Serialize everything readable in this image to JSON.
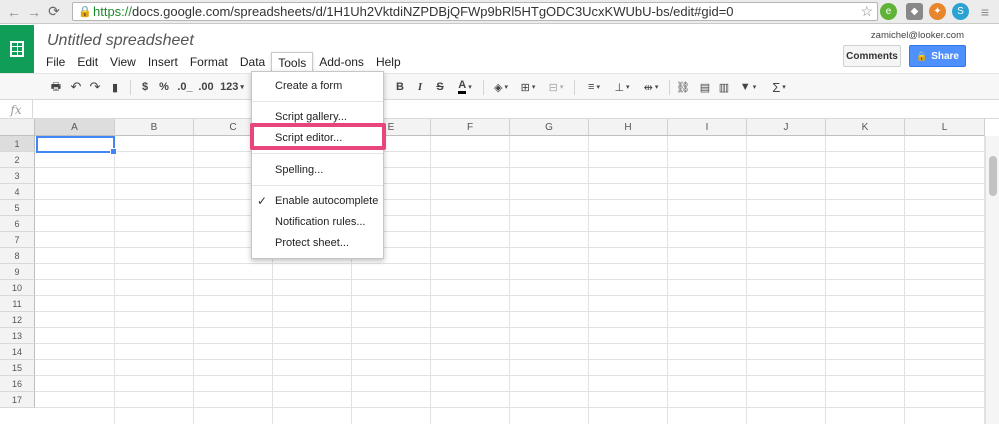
{
  "browser": {
    "url_scheme": "https://",
    "url_rest": "docs.google.com/spreadsheets/d/1H1Uh2VktdiNZPDBjQFWp9bRl5HTgODC3UcxKWUbU-bs/edit#gid=0"
  },
  "app": {
    "title": "Untitled spreadsheet",
    "user_email": "zamichel@looker.com",
    "comments_label": "Comments",
    "share_label": "Share",
    "accent": "#0f9d58",
    "share_color": "#4d90fe"
  },
  "menubar": {
    "items": [
      "File",
      "Edit",
      "View",
      "Insert",
      "Format",
      "Data",
      "Tools",
      "Add-ons",
      "Help"
    ]
  },
  "toolbar": {
    "dollar": "$",
    "percent": "%",
    "dec_less": ".0_",
    "dec_more": ".00",
    "more_formats": "123",
    "bold": "B",
    "italic": "I",
    "strike": "S",
    "text_color": "A",
    "sum": "Σ"
  },
  "formula": {
    "fx": "fx"
  },
  "grid": {
    "columns": [
      "A",
      "B",
      "C",
      "D",
      "E",
      "F",
      "G",
      "H",
      "I",
      "J",
      "K",
      "L"
    ],
    "rows": [
      "1",
      "2",
      "3",
      "4",
      "5",
      "6",
      "7",
      "8",
      "9",
      "10",
      "11",
      "12",
      "13",
      "14",
      "15",
      "16",
      "17"
    ]
  },
  "tools_menu": {
    "items": {
      "create_form": "Create a form",
      "script_gallery": "Script gallery...",
      "script_editor": "Script editor...",
      "spelling": "Spelling...",
      "autocomplete": "Enable autocomplete",
      "notification_rules": "Notification rules...",
      "protect_sheet": "Protect sheet..."
    },
    "highlight_color": "#e8457b"
  }
}
